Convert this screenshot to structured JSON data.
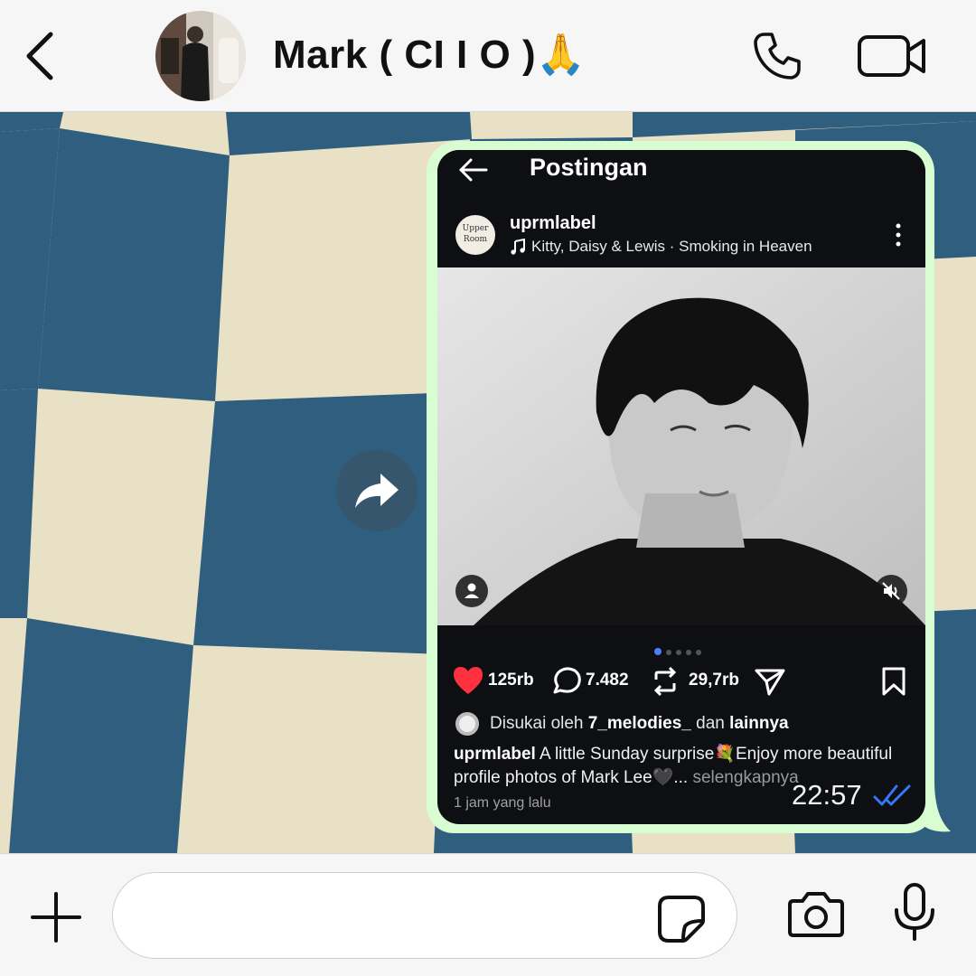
{
  "header": {
    "contact_name": "Mark ( CI I O )🙏",
    "icons": {
      "back": "chevron-left-icon",
      "call": "phone-icon",
      "video": "video-camera-icon"
    }
  },
  "message": {
    "forward_icon": "forward-arrow-icon",
    "time": "22:57",
    "read_receipt_color": "#3478f6",
    "bubble_color": "#d8fdd2"
  },
  "post": {
    "page_title": "Postingan",
    "avatar_text_line1": "Upper",
    "avatar_text_line2": "Room",
    "username": "uprmlabel",
    "music": "Kitty, Daisy & Lewis · Smoking in Heaven",
    "carousel_count": 5,
    "carousel_active": 1,
    "likes": "125rb",
    "comments": "7.482",
    "reposts": "29,7rb",
    "liked_prefix": "Disukai oleh",
    "liked_user": "7_melodies_",
    "liked_connector": "dan",
    "liked_others": "lainnya",
    "caption_user": "uprmlabel",
    "caption_text": "A little Sunday surprise💐Enjoy more beautiful profile photos of Mark Lee🖤...",
    "caption_more": "selengkapnya",
    "time_ago": "1 jam yang lalu",
    "like_color": "#ff3040"
  },
  "composer": {
    "input_value": "",
    "icons": {
      "plus": "plus-icon",
      "sticker": "sticker-icon",
      "camera": "camera-icon",
      "mic": "microphone-icon"
    }
  }
}
